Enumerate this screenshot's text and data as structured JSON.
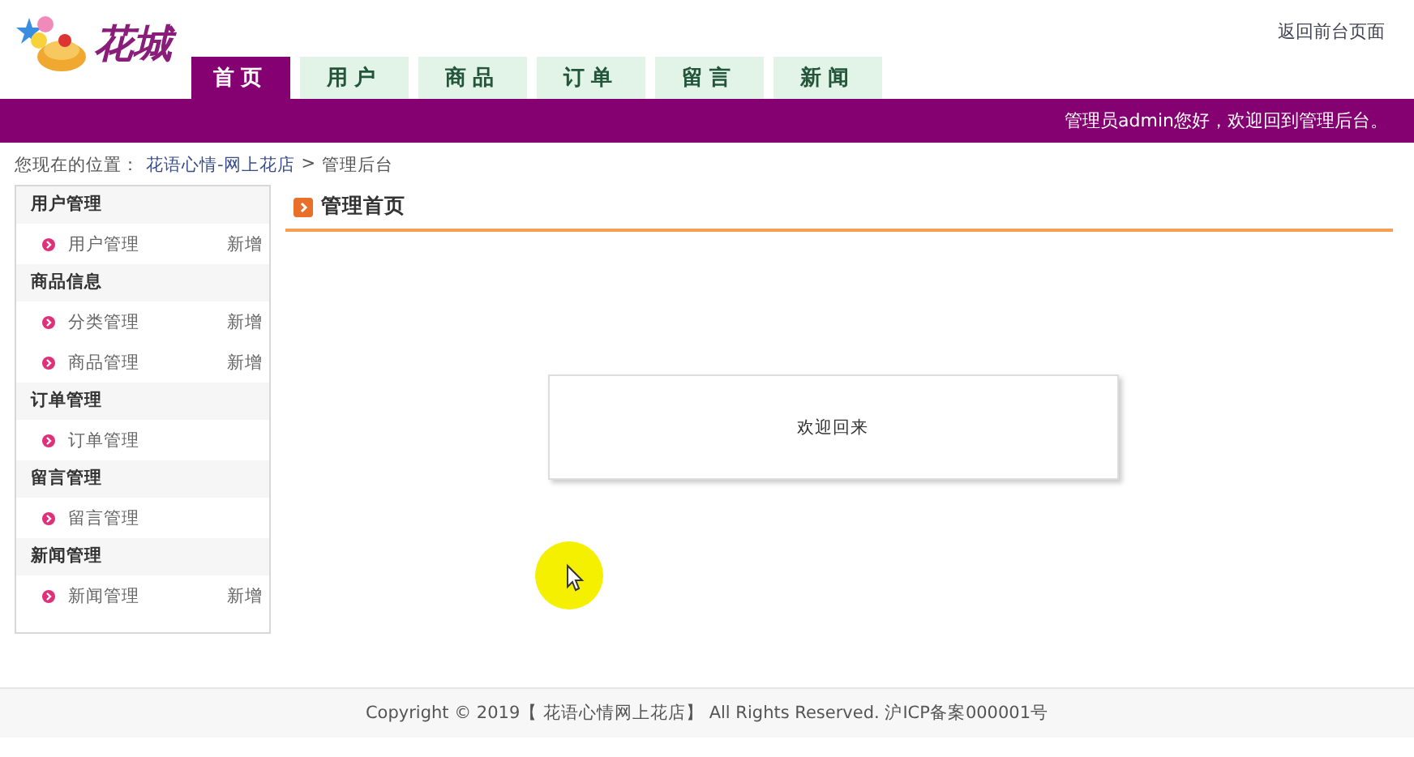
{
  "logo": {
    "text": "花城"
  },
  "top_link": "返回前台页面",
  "tabs": [
    {
      "label": "首页",
      "selected": true
    },
    {
      "label": "用户",
      "selected": false
    },
    {
      "label": "商品",
      "selected": false
    },
    {
      "label": "订单",
      "selected": false
    },
    {
      "label": "留言",
      "selected": false
    },
    {
      "label": "新闻",
      "selected": false
    }
  ],
  "greeting": "管理员admin您好，欢迎回到管理后台。",
  "breadcrumb": {
    "prefix": "您现在的位置：",
    "link": "花语心情-网上花店",
    "separator": ">",
    "current": "管理后台"
  },
  "sidebar": [
    {
      "title": "用户管理",
      "items": [
        {
          "label": "用户管理",
          "action": "新增"
        }
      ]
    },
    {
      "title": "商品信息",
      "items": [
        {
          "label": "分类管理",
          "action": "新增"
        },
        {
          "label": "商品管理",
          "action": "新增"
        }
      ]
    },
    {
      "title": "订单管理",
      "items": [
        {
          "label": "订单管理"
        }
      ]
    },
    {
      "title": "留言管理",
      "items": [
        {
          "label": "留言管理"
        }
      ]
    },
    {
      "title": "新闻管理",
      "items": [
        {
          "label": "新闻管理",
          "action": "新增"
        }
      ]
    }
  ],
  "main": {
    "title": "管理首页",
    "message": "欢迎回来"
  },
  "footer": "Copyright © 2019【 花语心情网上花店】 All Rights Reserved. 沪ICP备案000001号"
}
